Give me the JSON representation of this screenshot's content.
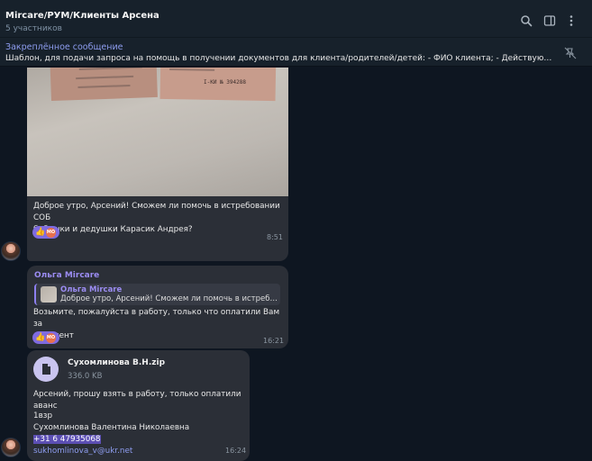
{
  "header": {
    "title": "Mircare/РУМ/Клиенты Арсена",
    "subtitle": "5 участников"
  },
  "pinned": {
    "title": "Закреплённое сообщение",
    "text": "Шаблон, для подачи запроса на помощь в получении документов для клиента/родителей/детей: - ФИО клиента; - Действующий клиент или к..."
  },
  "messages": [
    {
      "photo_text": "I-КИ № 394288",
      "text_line1": "Доброе утро, Арсений! Сможем ли помочь в истребовании СОБ",
      "text_line2": "бабушки и дедушки Карасик Андрея?",
      "time": "8:51",
      "reaction": {
        "emoji": "👍",
        "avatar_text": "MO"
      }
    },
    {
      "sender": "Ольга Mircare",
      "reply_name": "Ольга Mircare",
      "reply_text": "Доброе утро, Арсений! Сможем ли помочь в истребов...",
      "text_line1": "Возьмите, пожалуйста в работу, только что оплатили Вам за",
      "text_line2": "документ",
      "time": "16:21",
      "reaction": {
        "emoji": "👍",
        "avatar_text": "MO"
      }
    },
    {
      "file_name": "Сухомлинова В.Н.zip",
      "file_size": "336.0 KB",
      "line1": "Арсений, прошу взять в работу, только оплатили аванс",
      "line2": "1взр",
      "line3": "Сухомлинова Валентина Николаевна",
      "phone": "+31 6 47935068",
      "email": "sukhomlinova_v@ukr.net",
      "time": "16:24"
    }
  ],
  "icons": [
    "search-icon",
    "sidebar-toggle-icon",
    "more-vert-icon",
    "unpin-icon",
    "file-icon"
  ],
  "colors": {
    "accent": "#8e9df0",
    "sender": "#9b8cf2",
    "bubble": "#2b2f37",
    "background": "#0e1621"
  }
}
